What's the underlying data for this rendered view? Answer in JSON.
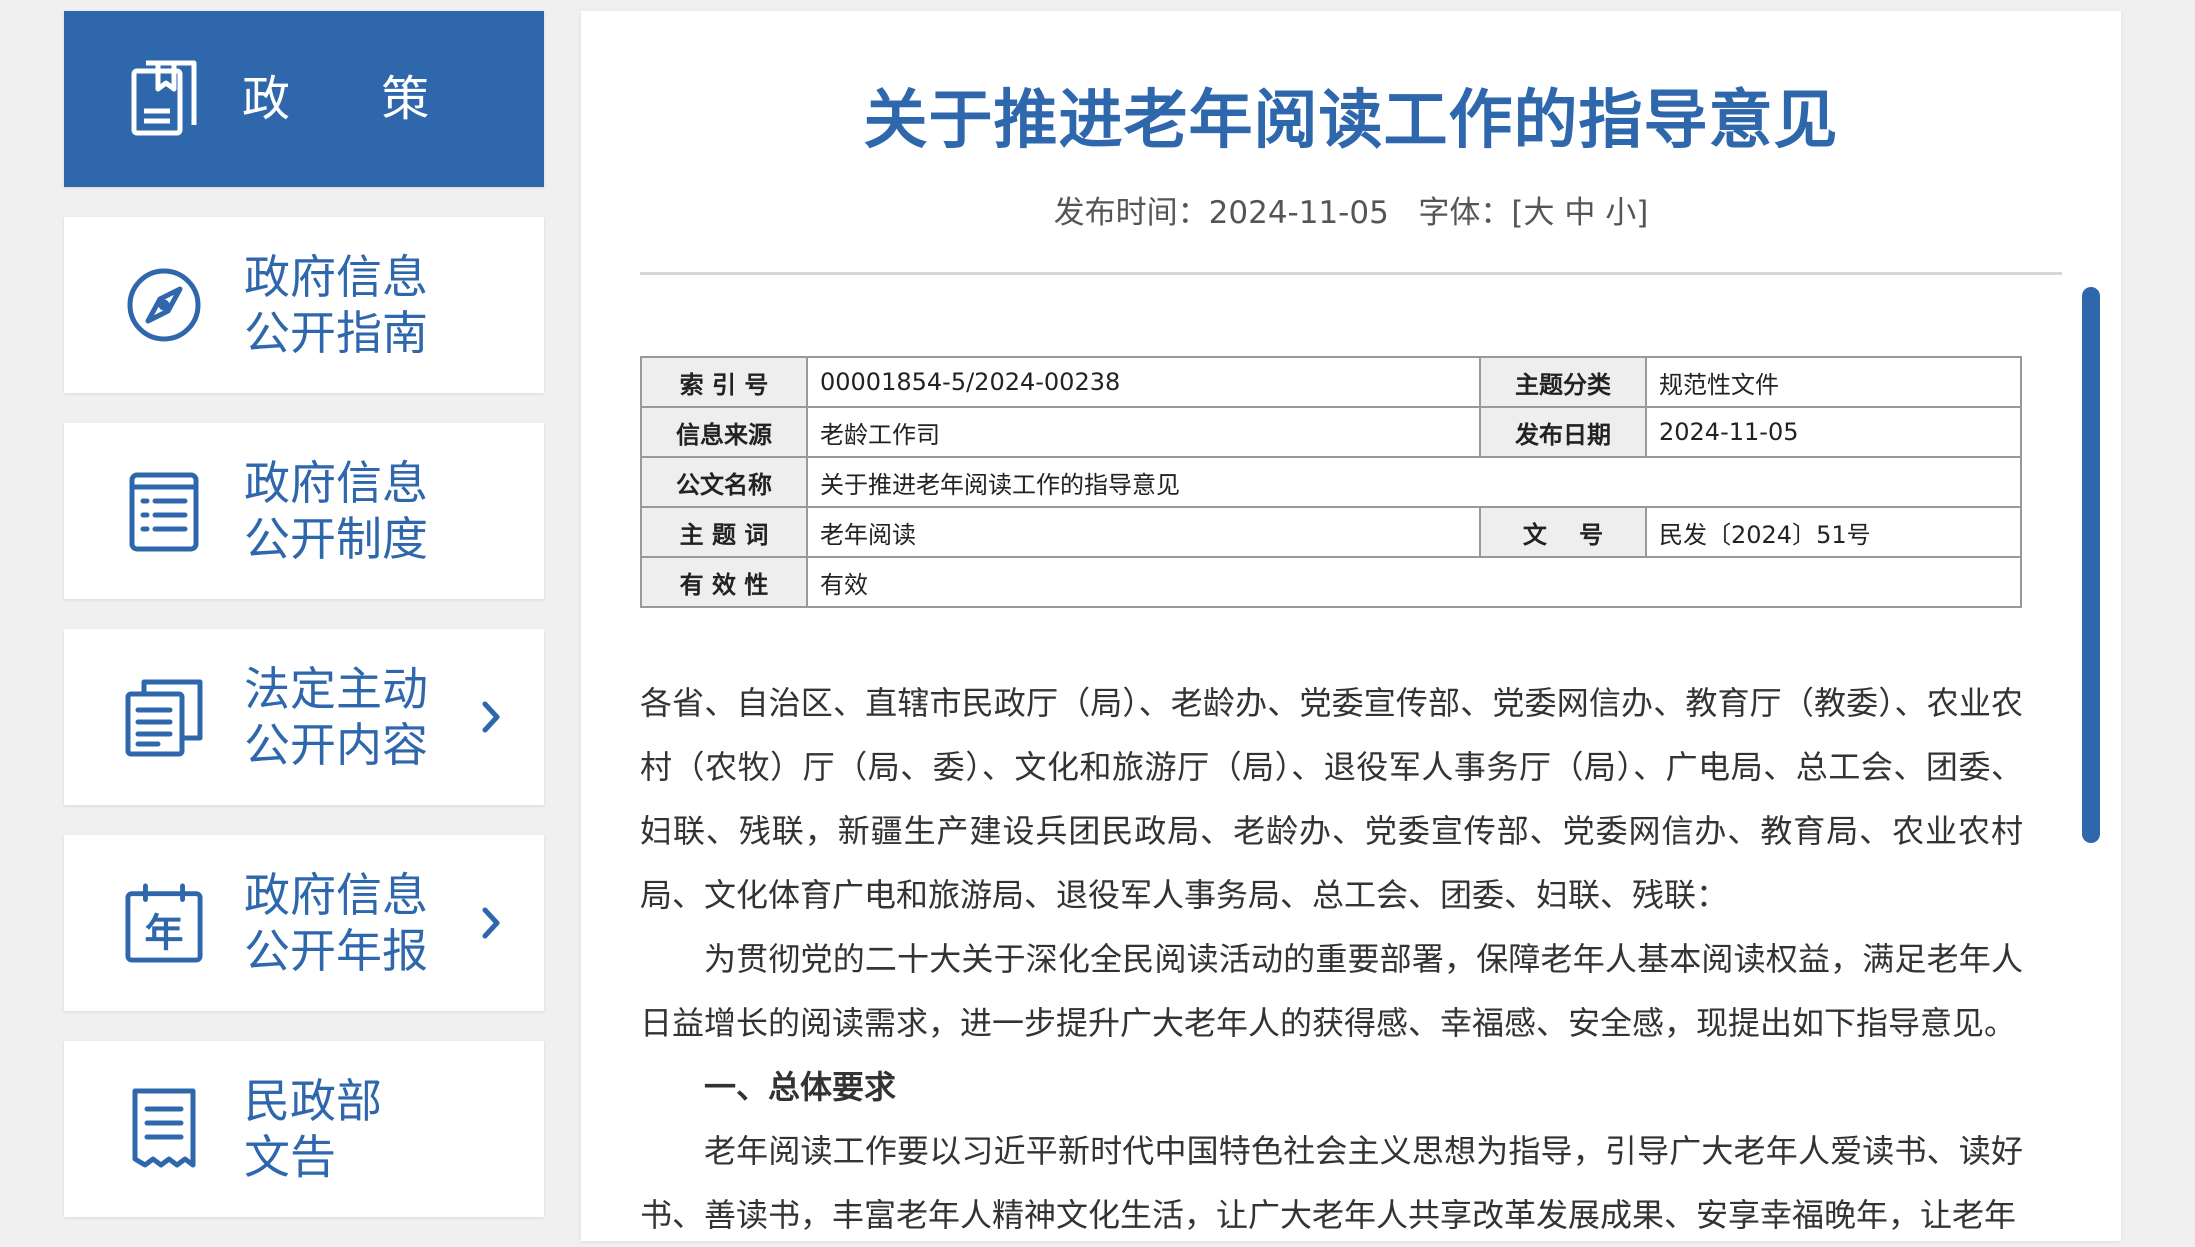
{
  "sidebar": {
    "items": [
      {
        "lines": [
          "政 策"
        ],
        "icon": "document-stack-icon",
        "active": true,
        "chevron": false
      },
      {
        "lines": [
          "政府信息",
          "公开指南"
        ],
        "icon": "compass-icon",
        "active": false,
        "chevron": false
      },
      {
        "lines": [
          "政府信息",
          "公开制度"
        ],
        "icon": "list-document-icon",
        "active": false,
        "chevron": false
      },
      {
        "lines": [
          "法定主动",
          "公开内容"
        ],
        "icon": "documents-icon",
        "active": false,
        "chevron": true
      },
      {
        "lines": [
          "政府信息",
          "公开年报"
        ],
        "icon": "calendar-year-icon",
        "active": false,
        "chevron": true
      },
      {
        "lines": [
          "民政部",
          "文告"
        ],
        "icon": "receipt-document-icon",
        "active": false,
        "chevron": false
      }
    ]
  },
  "document": {
    "title": "关于推进老年阅读工作的指导意见",
    "publish_label": "发布时间：",
    "publish_date": "2024-11-05",
    "font_label": "字体：",
    "font_open": "[",
    "font_large": "大",
    "font_medium": "中",
    "font_small": "小",
    "font_close": "]"
  },
  "info_table": {
    "index_no_label": "索 引 号",
    "index_no": "00001854-5/2024-00238",
    "category_label": "主题分类",
    "category": "规范性文件",
    "source_label": "信息来源",
    "source": "老龄工作司",
    "date_label": "发布日期",
    "date": "2024-11-05",
    "doc_name_label": "公文名称",
    "doc_name": "关于推进老年阅读工作的指导意见",
    "keyword_label": "主 题 词",
    "keyword": "老年阅读",
    "doc_no_label": "文　 号",
    "doc_no": "民发〔2024〕51号",
    "validity_label": "有 效 性",
    "validity": "有效"
  },
  "body": {
    "p1": "各省、自治区、直辖市民政厅（局）、老龄办、党委宣传部、党委网信办、教育厅（教委）、农业农村（农牧）厅（局、委）、文化和旅游厅（局）、退役军人事务厅（局）、广电局、总工会、团委、妇联、残联，新疆生产建设兵团民政局、老龄办、党委宣传部、党委网信办、教育局、农业农村局、文化体育广电和旅游局、退役军人事务局、总工会、团委、妇联、残联：",
    "p2": "为贯彻党的二十大关于深化全民阅读活动的重要部署，保障老年人基本阅读权益，满足老年人日益增长的阅读需求，进一步提升广大老年人的获得感、幸福感、安全感，现提出如下指导意见。",
    "h1": "一、总体要求",
    "p3": "老年阅读工作要以习近平新时代中国特色社会主义思想为指导，引导广大老年人爱读书、读好书、善读书，丰富老年人精神文化生活，让广大老年人共享改革发展成果、安享幸福晚年，让老年"
  },
  "colors": {
    "accent": "#2f67ad",
    "background": "#f0f0f0",
    "table_header_bg": "#eeeeee"
  }
}
